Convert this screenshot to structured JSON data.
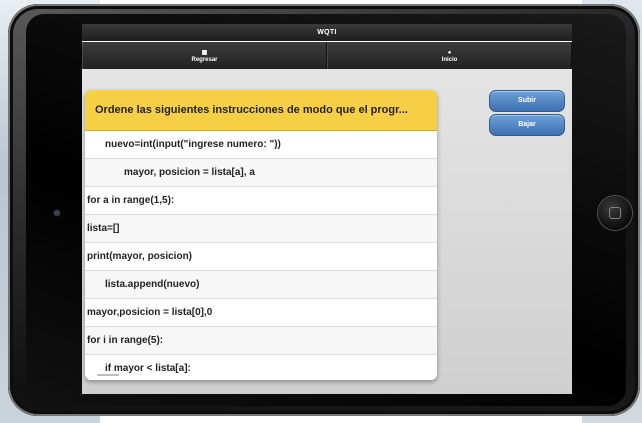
{
  "app": {
    "title": "WQTI"
  },
  "nav": {
    "back_label": "Regresar",
    "home_label": "Inicio"
  },
  "question": {
    "prompt": "Ordene las siguientes instrucciones de modo que el progr..."
  },
  "items": [
    {
      "text": "nuevo=int(input(\"ingrese numero: \"))",
      "indent": 1
    },
    {
      "text": "mayor, posicion = lista[a], a",
      "indent": 2
    },
    {
      "text": "for a in range(1,5):",
      "indent": 0
    },
    {
      "text": "lista=[]",
      "indent": 0
    },
    {
      "text": "print(mayor, posicion)",
      "indent": 0
    },
    {
      "text": "lista.append(nuevo)",
      "indent": 1
    },
    {
      "text": "mayor,posicion = lista[0],0",
      "indent": 0
    },
    {
      "text": "for i in range(5):",
      "indent": 0
    },
    {
      "text": "if mayor < lista[a]:",
      "indent": 1
    }
  ],
  "buttons": {
    "up_label": "Subir",
    "down_label": "Bajar"
  },
  "icons": {
    "back": "grid-icon",
    "home": "home-icon"
  },
  "colors": {
    "header_yellow": "#f7cf44",
    "button_blue": "#4a7fc1",
    "nav_dark": "#2a2a2a"
  }
}
